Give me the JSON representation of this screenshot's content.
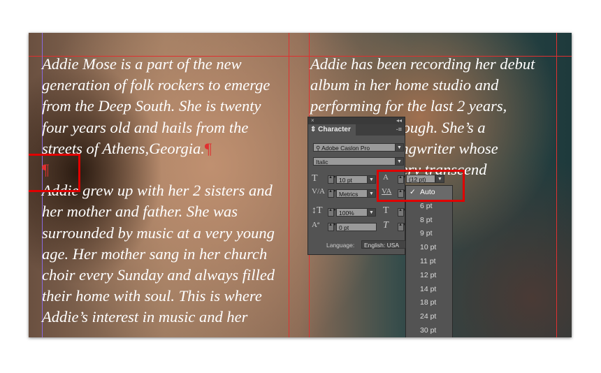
{
  "column1": {
    "lines": [
      "Addie Mose is a part of the new",
      "generation of folk rockers to emerge",
      "from the Deep South. She is twenty",
      "four years old and hails from the",
      "streets of Athens,Georgia.",
      "",
      "Addie grew up with her 2 sisters and",
      "her mother and father. She was",
      "surrounded by music at a very young",
      "age. Her mother sang in her church",
      "choir every Sunday and always filled",
      "their home with soul. This is where",
      "Addie’s  interest in music and her"
    ],
    "pilcrow": "¶"
  },
  "column2": {
    "lines": [
      "Addie has been recording her debut",
      "album in her home studio and",
      "performing for the last 2 years,",
      "                      rough. She’s a",
      "                       ngwriter whose",
      "                       ery transcend"
    ]
  },
  "panel": {
    "title": "Character",
    "font_family": "Adobe Caslon Pro",
    "font_style": "Italic",
    "font_size": "10 pt",
    "leading": "(12 pt)",
    "kerning": "Metrics",
    "vertical_scale": "100%",
    "baseline_shift": "0 pt",
    "language_label": "Language:",
    "language": "English: USA",
    "close": "×",
    "collapse": "◂◂",
    "menu": "-≡"
  },
  "leading_dropdown": {
    "selected": "Auto",
    "check": "✓",
    "options": [
      "6 pt",
      "8 pt",
      "9 pt",
      "10 pt",
      "11 pt",
      "12 pt",
      "14 pt",
      "18 pt",
      "24 pt",
      "30 pt"
    ]
  },
  "colors": {
    "highlight": "#e00000",
    "panel": "#535353"
  }
}
